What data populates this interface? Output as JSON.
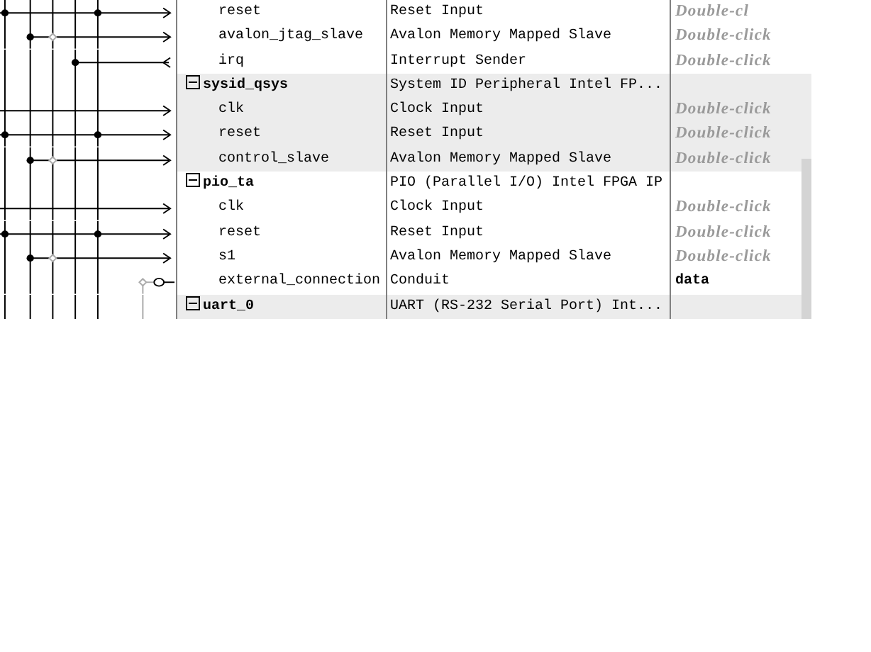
{
  "components": [
    {
      "ports": [
        {
          "name": "reset",
          "description": "Reset Input",
          "export": "Double-cl",
          "exported": false,
          "kind": "reset"
        },
        {
          "name": "avalon_jtag_slave",
          "description": "Avalon Memory Mapped Slave",
          "export": "Double-click",
          "exported": false,
          "kind": "avalon"
        },
        {
          "name": "irq",
          "description": "Interrupt Sender",
          "export": "Double-click",
          "exported": false,
          "kind": "irq"
        }
      ]
    },
    {
      "name": "sysid_qsys",
      "description": "System ID Peripheral Intel FP...",
      "expanded": true,
      "ports": [
        {
          "name": "clk",
          "description": "Clock Input",
          "export": "Double-click",
          "exported": false,
          "kind": "clock"
        },
        {
          "name": "reset",
          "description": "Reset Input",
          "export": "Double-click",
          "exported": false,
          "kind": "reset"
        },
        {
          "name": "control_slave",
          "description": "Avalon Memory Mapped Slave",
          "export": "Double-click",
          "exported": false,
          "kind": "avalon"
        }
      ]
    },
    {
      "name": "pio_ta",
      "description": "PIO (Parallel I/O) Intel FPGA IP",
      "expanded": true,
      "ports": [
        {
          "name": "clk",
          "description": "Clock Input",
          "export": "Double-click",
          "exported": false,
          "kind": "clock"
        },
        {
          "name": "reset",
          "description": "Reset Input",
          "export": "Double-click",
          "exported": false,
          "kind": "reset"
        },
        {
          "name": "s1",
          "description": "Avalon Memory Mapped Slave",
          "export": "Double-click",
          "exported": false,
          "kind": "avalon"
        },
        {
          "name": "external_connection",
          "description": "Conduit",
          "export": "data",
          "exported": true,
          "kind": "conduit"
        }
      ]
    },
    {
      "name": "uart_0",
      "description": "UART (RS-232 Serial Port) Int...",
      "expanded": true
    }
  ]
}
